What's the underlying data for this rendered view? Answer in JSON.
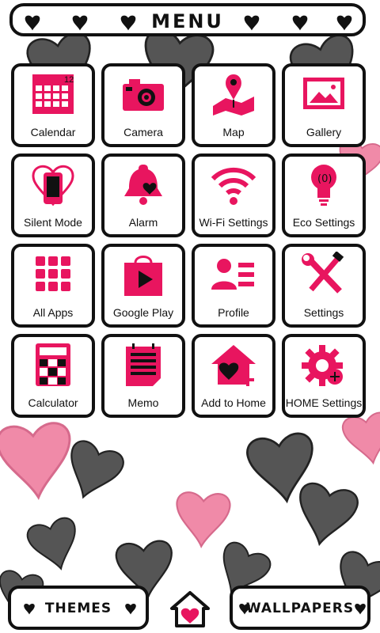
{
  "colors": {
    "accent": "#e8155f",
    "dark": "#111111",
    "pink_heart": "#f08aa8",
    "grey_heart": "#5a5a5a"
  },
  "header": {
    "title": "MENU"
  },
  "apps": [
    {
      "label": "Calendar",
      "icon": "calendar-icon",
      "badge": "12"
    },
    {
      "label": "Camera",
      "icon": "camera-icon"
    },
    {
      "label": "Map",
      "icon": "map-icon"
    },
    {
      "label": "Gallery",
      "icon": "gallery-icon"
    },
    {
      "label": "Silent Mode",
      "icon": "silent-mode-icon"
    },
    {
      "label": "Alarm",
      "icon": "alarm-icon"
    },
    {
      "label": "Wi-Fi Settings",
      "icon": "wifi-icon"
    },
    {
      "label": "Eco Settings",
      "icon": "eco-bulb-icon"
    },
    {
      "label": "All Apps",
      "icon": "all-apps-icon"
    },
    {
      "label": "Google Play",
      "icon": "google-play-icon"
    },
    {
      "label": "Profile",
      "icon": "profile-icon"
    },
    {
      "label": "Settings",
      "icon": "settings-tools-icon"
    },
    {
      "label": "Calculator",
      "icon": "calculator-icon"
    },
    {
      "label": "Memo",
      "icon": "memo-icon"
    },
    {
      "label": "Add to Home",
      "icon": "add-to-home-icon"
    },
    {
      "label": "HOME Settings",
      "icon": "home-settings-icon"
    }
  ],
  "footer": {
    "themes_label": "THEMES",
    "wallpapers_label": "WALLPAPERS",
    "home_icon": "home-heart-icon"
  }
}
